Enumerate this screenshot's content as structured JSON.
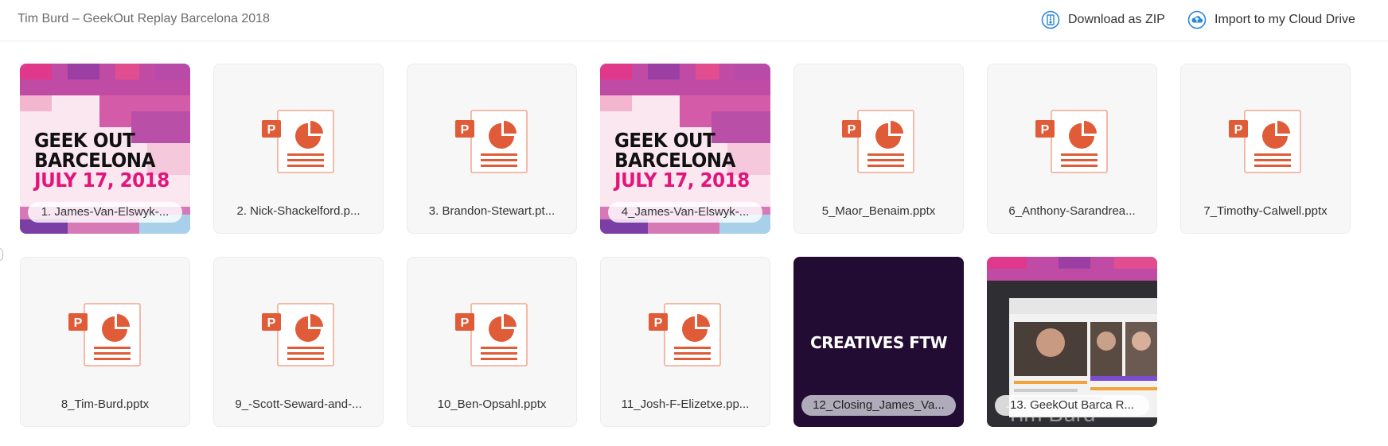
{
  "header": {
    "title": "Tim Burd – GeekOut Replay Barcelona 2018",
    "actions": [
      {
        "label": "Download as ZIP",
        "icon": "download-zip-icon"
      },
      {
        "label": "Import to my Cloud Drive",
        "icon": "cloud-upload-icon"
      }
    ]
  },
  "colors": {
    "accent": "#2b88d8",
    "ppt_orange": "#e05c38",
    "geek_pink": "#e3157a",
    "closing_bg": "#230c33"
  },
  "files": [
    {
      "name": "1. James-Van-Elswyk-...",
      "kind": "image",
      "thumb": "geekout-barcelona"
    },
    {
      "name": "2. Nick-Shackelford.p...",
      "kind": "pptx",
      "thumb": "powerpoint-icon"
    },
    {
      "name": "3. Brandon-Stewart.pt...",
      "kind": "pptx",
      "thumb": "powerpoint-icon"
    },
    {
      "name": "4_James-Van-Elswyk-...",
      "kind": "image",
      "thumb": "geekout-barcelona"
    },
    {
      "name": "5_Maor_Benaim.pptx",
      "kind": "pptx",
      "thumb": "powerpoint-icon"
    },
    {
      "name": "6_Anthony-Sarandrea...",
      "kind": "pptx",
      "thumb": "powerpoint-icon"
    },
    {
      "name": "7_Timothy-Calwell.pptx",
      "kind": "pptx",
      "thumb": "powerpoint-icon"
    },
    {
      "name": "8_Tim-Burd.pptx",
      "kind": "pptx",
      "thumb": "powerpoint-icon"
    },
    {
      "name": "9_-Scott-Seward-and-...",
      "kind": "pptx",
      "thumb": "powerpoint-icon"
    },
    {
      "name": "10_Ben-Opsahl.pptx",
      "kind": "pptx",
      "thumb": "powerpoint-icon"
    },
    {
      "name": "11_Josh-F-Elizetxe.pp...",
      "kind": "pptx",
      "thumb": "powerpoint-icon"
    },
    {
      "name": "12_Closing_James_Va...",
      "kind": "video",
      "thumb": "creatives-ftw"
    },
    {
      "name": "13. GeekOut Barca R...",
      "kind": "video",
      "thumb": "webinar-screenshot"
    }
  ],
  "thumb_text": {
    "geekout": [
      "GEEK OUT",
      "BARCELONA",
      "JULY 17, 2018"
    ],
    "closing": "CREATIVES FTW",
    "video_watermark": "Tim Burd"
  }
}
